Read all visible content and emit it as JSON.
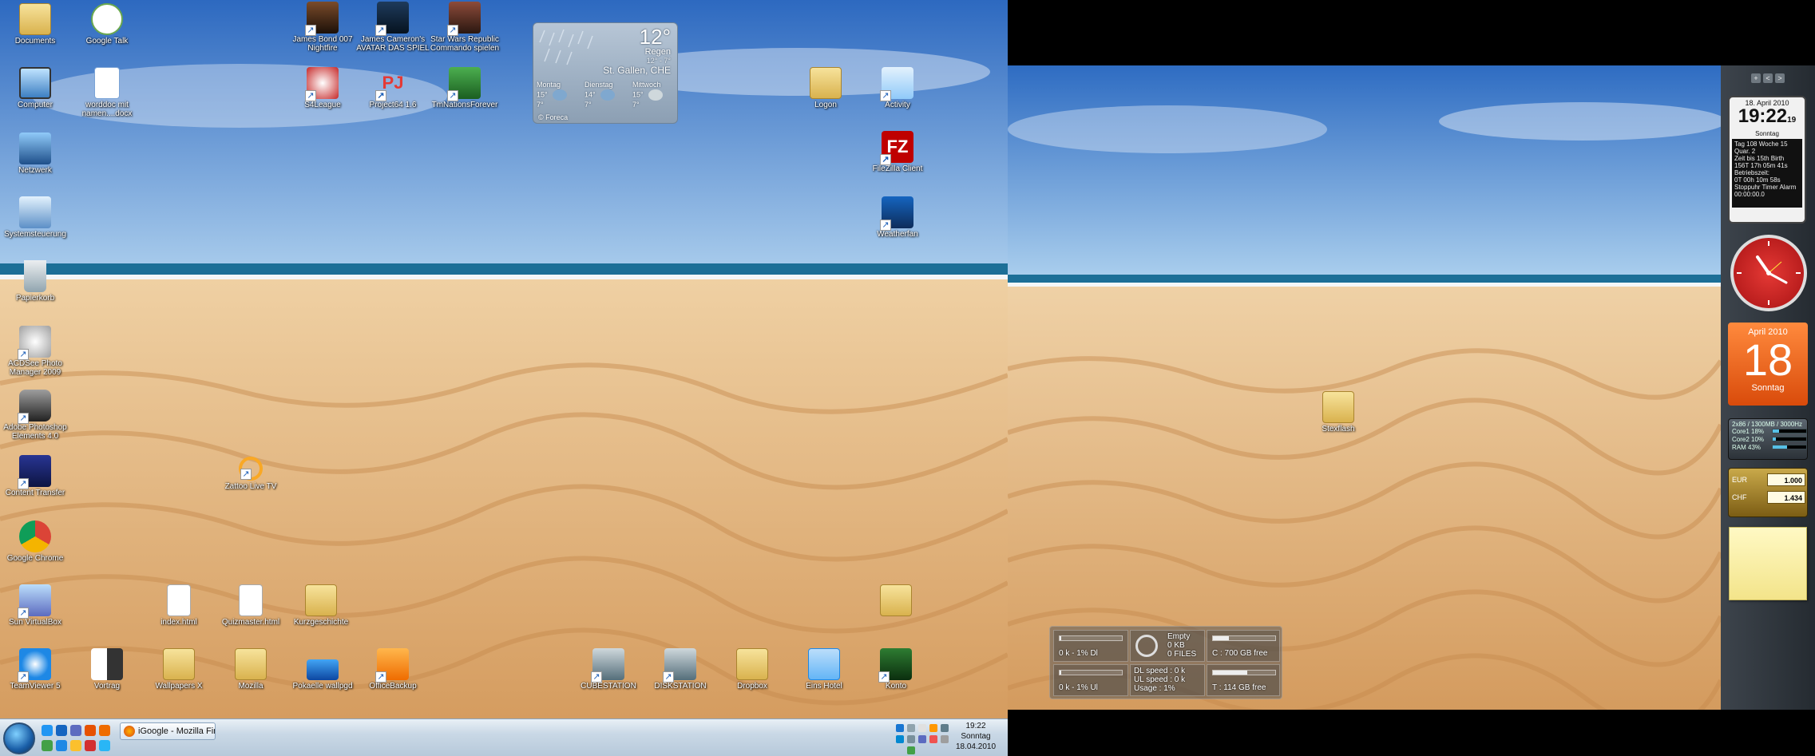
{
  "left_desktop": {
    "icons": [
      {
        "id": "documents",
        "label": "Documents",
        "kind": "folder"
      },
      {
        "id": "google-talk",
        "label": "Google Talk",
        "kind": "talk"
      },
      {
        "id": "james-bond",
        "label": "James Bond 007 Nightfire",
        "kind": "game"
      },
      {
        "id": "avatar",
        "label": "James Cameron's AVATAR DAS SPIEL",
        "kind": "game"
      },
      {
        "id": "starwars",
        "label": "Star Wars Republic Commando spielen",
        "kind": "game"
      },
      {
        "id": "computer",
        "label": "Computer",
        "kind": "computer"
      },
      {
        "id": "worddoc",
        "label": "worddoc mit namen....docx",
        "kind": "doc"
      },
      {
        "id": "s4league",
        "label": "S4League",
        "kind": "game"
      },
      {
        "id": "project64",
        "label": "Project64 1.6",
        "kind": "game"
      },
      {
        "id": "tmnations",
        "label": "TmNationsForever",
        "kind": "game"
      },
      {
        "id": "logon",
        "label": "Logon",
        "kind": "folder"
      },
      {
        "id": "activity",
        "label": "Activity",
        "kind": "app"
      },
      {
        "id": "network",
        "label": "Netzwerk",
        "kind": "network"
      },
      {
        "id": "filezilla",
        "label": "FileZilla Client",
        "kind": "filezilla"
      },
      {
        "id": "systemsteuerung",
        "label": "Systemsteuerung",
        "kind": "control"
      },
      {
        "id": "weatherfan",
        "label": "Weatherfan",
        "kind": "app"
      },
      {
        "id": "papierkorb",
        "label": "Papierkorb",
        "kind": "trash"
      },
      {
        "id": "acdsee",
        "label": "ACDSee Photo Manager 2009",
        "kind": "app"
      },
      {
        "id": "photoshop",
        "label": "Adobe Photoshop Elements 4.0",
        "kind": "camera"
      },
      {
        "id": "zattoo",
        "label": "Zattoo Live TV",
        "kind": "zattoo"
      },
      {
        "id": "content-transfer",
        "label": "Content Transfer",
        "kind": "app"
      },
      {
        "id": "chrome",
        "label": "Google Chrome",
        "kind": "chrome"
      },
      {
        "id": "virtualbox",
        "label": "Sun VirtualBox",
        "kind": "app"
      },
      {
        "id": "indexhtml",
        "label": "index.html",
        "kind": "html"
      },
      {
        "id": "quizmaster",
        "label": "Quizmaster.html",
        "kind": "html"
      },
      {
        "id": "kurzgeschichte",
        "label": "Kurzgeschichte",
        "kind": "folder"
      },
      {
        "id": "folder-right",
        "label": "",
        "kind": "folder"
      },
      {
        "id": "teamviewer",
        "label": "TeamViewer 5",
        "kind": "teamviewer"
      },
      {
        "id": "vortrag",
        "label": "Vortrag",
        "kind": "doc"
      },
      {
        "id": "wallpapers",
        "label": "Wallpapers X",
        "kind": "folder"
      },
      {
        "id": "mozilla",
        "label": "Mozilla",
        "kind": "folder"
      },
      {
        "id": "pokaelle",
        "label": "Pokaelle wallpgd",
        "kind": "image"
      },
      {
        "id": "officebackup",
        "label": "OfficeBackup",
        "kind": "office"
      },
      {
        "id": "cubestation",
        "label": "CUBESTATION",
        "kind": "network"
      },
      {
        "id": "diskstation",
        "label": "DISKSTATION",
        "kind": "network"
      },
      {
        "id": "dropbox",
        "label": "Dropbox",
        "kind": "folder"
      },
      {
        "id": "eins-hotel",
        "label": "Eins Hotel",
        "kind": "folder"
      },
      {
        "id": "konto",
        "label": "Konto",
        "kind": "app"
      }
    ]
  },
  "weather_gadget": {
    "temp": "12°",
    "condition": "Regen",
    "range": "12° - 7°",
    "city": "St. Gallen, CHE",
    "days": [
      {
        "name": "Montag",
        "hi": "15°",
        "lo": "7°"
      },
      {
        "name": "Dienstag",
        "hi": "14°",
        "lo": "7°"
      },
      {
        "name": "Mittwoch",
        "hi": "15°",
        "lo": "7°"
      }
    ],
    "provider": "© Foreca"
  },
  "taskbar": {
    "task_label": "iGoogle - Mozilla Fir...",
    "clock_time": "19:22",
    "clock_day": "Sonntag",
    "clock_date": "18.04.2010"
  },
  "right_desktop": {
    "icons": [
      {
        "id": "stexflash",
        "label": "Stexflash",
        "kind": "folder"
      }
    ]
  },
  "net_gadget": {
    "empty_title": "Empty",
    "empty_kb": "0 KB",
    "empty_files": "0 FILES",
    "dl_speed": "DL speed : 0 k",
    "ul_speed": "UL speed : 0 k",
    "usage": "Usage : 1%",
    "dl": "0 k - 1% Dl",
    "ul": "0 k - 1% Ul",
    "c_free": "C : 700 GB free",
    "t_free": "T : 114 GB free",
    "c_fill": 0.25,
    "t_fill": 0.55
  },
  "sidebar": {
    "buttons": [
      "+",
      "<",
      ">"
    ],
    "clock": {
      "date": "18. April 2010",
      "time": "19:22",
      "seconds": "19",
      "day": "Sonntag",
      "lines": [
        "Tag 108 Woche 15 Quar. 2",
        "Zeit bis 15th Birth",
        "156T 17h 05m 41s",
        "Betriebszeit:",
        "0T 00h 10m 58s",
        "Stoppuhr Timer Alarm",
        "00:00:00.0"
      ]
    },
    "calendar": {
      "month": "April 2010",
      "day": "18",
      "weekday": "Sonntag"
    },
    "cpu": {
      "header": "2x86 / 1300MB / 3000Hz",
      "rows": [
        {
          "name": "Core1",
          "val": "18%",
          "fill": 0.18
        },
        {
          "name": "Core2",
          "val": "10%",
          "fill": 0.1
        },
        {
          "name": "RAM",
          "val": "43%",
          "fill": 0.43
        }
      ]
    },
    "currency": {
      "rows": [
        {
          "name": "EUR",
          "val": "1.000"
        },
        {
          "name": "CHF",
          "val": "1.434"
        }
      ]
    }
  },
  "colors": {
    "sky_top": "#2f6fc5",
    "sand": "#e8b983",
    "sea": "#1c6f97"
  }
}
